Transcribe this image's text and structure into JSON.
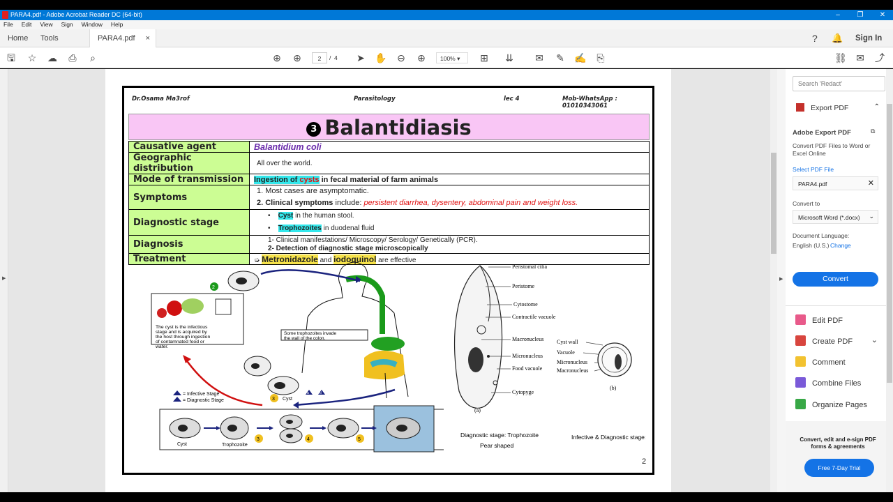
{
  "window": {
    "title": "PARA4.pdf - Adobe Acrobat Reader DC (64-bit)"
  },
  "menu": [
    "File",
    "Edit",
    "View",
    "Sign",
    "Window",
    "Help"
  ],
  "tabs": {
    "home": "Home",
    "tools": "Tools",
    "doc": "PARA4.pdf",
    "close": "×"
  },
  "account": {
    "signin": "Sign In"
  },
  "toolbar": {
    "page_current": "2",
    "page_sep": "/",
    "page_total": "4",
    "zoom": "100%"
  },
  "slide": {
    "author": "Dr.Osama Ma3rof",
    "subject": "Parasitology",
    "lecture": "lec 4",
    "contact": "Mob-WhatsApp : 01010343061",
    "number": "3",
    "title": "Balantidiasis",
    "page_number": "2",
    "rows": {
      "agent": {
        "label": "Causative agent",
        "value": "Balantidium coli"
      },
      "geo": {
        "label": "Geographic distribution",
        "value": "All over the world."
      },
      "transmission": {
        "label": "Mode of transmission",
        "pre": "Ingestion of ",
        "word": "cysts",
        "post": " in fecal material of farm animals"
      },
      "symptoms": {
        "label": "Symptoms",
        "line1": "1. Most cases are asymptomatic.",
        "line2_a": "2. Clinical symptoms",
        "line2_b": " include: ",
        "line2_c": "persistent diarrhea, dysentery, abdominal pain and weight loss."
      },
      "stage": {
        "label": "Diagnostic stage",
        "a_word": "Cyst",
        "a_rest": " in the human stool.",
        "b_word": "Trophozoites",
        "b_rest": " in duodenal fluid"
      },
      "diagnosis": {
        "label": "Diagnosis",
        "line1": "1-  Clinical manifestations/ Microscopy/ Serology/ Genetically (PCR).",
        "line2": "2-  Detection of diagnostic stage microscopically"
      },
      "treatment": {
        "label": "Treatment",
        "drug1": "Metronidazole",
        "and": " and ",
        "drug2": "iodoquinol",
        "rest": " are effective"
      }
    },
    "diagram": {
      "cyst_note": "The cyst is the infectious stage and is acquired by the host through ingestion of contamnated food or water.",
      "invade_note": "Some trophozoites invade the wall of the colon.",
      "legend_infective": "= Infective Stage",
      "legend_diagnostic": "= Diagnostic Stage",
      "cyst": "Cyst",
      "cyst2": "Cyst",
      "trophozoite": "Trophozoite",
      "marker_2": "2",
      "marker_3": "3",
      "marker_4": "4",
      "marker_5": "5",
      "marker_a": "a",
      "marker_d": "d"
    },
    "morph_labels": {
      "peristomal": "Peristomal cilia",
      "peristome": "Peristome",
      "cytostome": "Cytostome",
      "contractile": "Contractile vacuole",
      "macro": "Macronucleus",
      "micro": "Micronucleus",
      "food": "Food vacuole",
      "cytopyge": "Cytopyge",
      "a": "(a)",
      "cyst_wall": "Cyst wall",
      "vacuole": "Vacuole",
      "micro2": "Micronucleus",
      "macro2": "Macronucleus",
      "b": "(b)",
      "diag_caption1": "Diagnostic stage: Trophozoite",
      "diag_caption2": "Pear shaped",
      "infective_caption": "Infective & Diagnostic stage: cyst"
    }
  },
  "right_panel": {
    "search_placeholder": "Search 'Redact'",
    "export_header": "Export PDF",
    "adobe_export": "Adobe Export PDF",
    "convert_desc": "Convert PDF Files to Word or Excel Online",
    "select_file": "Select PDF File",
    "file_name": "PARA4.pdf",
    "convert_to": "Convert to",
    "format": "Microsoft Word (*.docx)",
    "doc_lang": "Document Language:",
    "lang": "English (U.S.)",
    "change": "Change",
    "convert_btn": "Convert",
    "tools": [
      "Edit PDF",
      "Create PDF",
      "Comment",
      "Combine Files",
      "Organize Pages"
    ],
    "promo": "Convert, edit and e-sign PDF forms & agreements",
    "trial": "Free 7-Day Trial"
  },
  "colors": {
    "accent": "#1473e6",
    "banner": "#f9c6f5",
    "label_bg": "#ccfd94",
    "cyan": "#33e8ec",
    "yellow": "#f7e34a"
  }
}
